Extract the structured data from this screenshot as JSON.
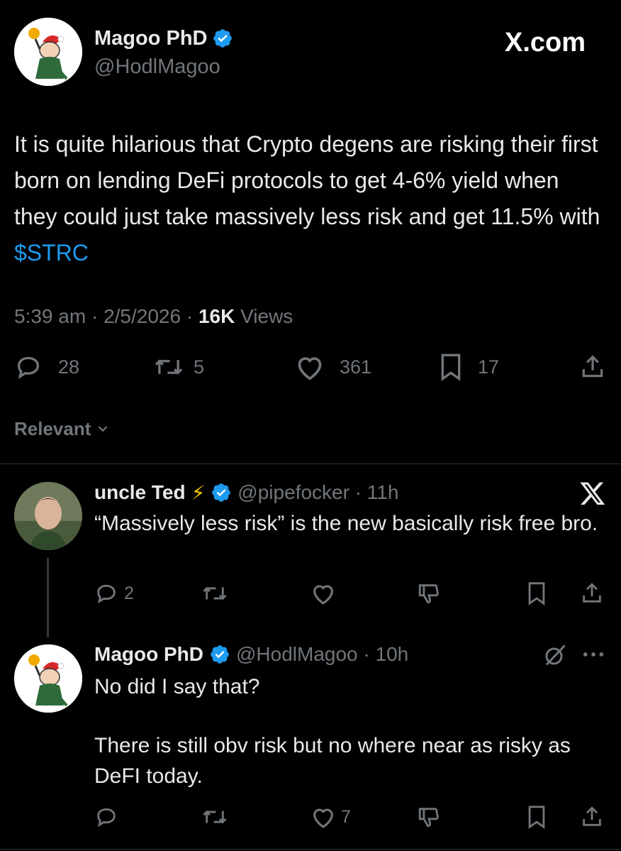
{
  "brand": {
    "site_logo_text": "X.com",
    "x_logo_text": "X"
  },
  "main_tweet": {
    "author_name": "Magoo PhD",
    "author_handle": "@HodlMagoo",
    "text_prefix": "It is quite hilarious that Crypto degens are risking their first born on lending DeFi protocols to get 4-6% yield when they could just take massively less risk and get 11.5% with ",
    "cashtag": "$STRC",
    "time": "5:39 am",
    "date": "2/5/2026",
    "views_count": "16K",
    "views_label": "Views",
    "replies": "28",
    "reposts": "5",
    "likes": "361",
    "bookmarks": "17"
  },
  "sort": {
    "label": "Relevant"
  },
  "reply1": {
    "author_name": "uncle Ted",
    "emoji": "⚡",
    "author_handle": "@pipefocker",
    "time": "11h",
    "text": "“Massively less risk” is the new basically risk free bro.",
    "replies": "2",
    "reposts": "",
    "likes": ""
  },
  "reply2": {
    "author_name": "Magoo PhD",
    "author_handle": "@HodlMagoo",
    "time": "10h",
    "text_line1": "No did I say that?",
    "text_line2": "There is still obv risk but no where near as risky as DeFI today.",
    "replies": "",
    "reposts": "",
    "likes": "7"
  },
  "colors": {
    "background": "#000000",
    "text": "#e7e9ea",
    "muted": "#71767b",
    "link": "#1d9bf0",
    "verified": "#1d9bf0",
    "divider": "#2f3336"
  },
  "icons": [
    "verified-badge-icon",
    "reply-icon",
    "repost-icon",
    "like-icon",
    "bookmark-icon",
    "share-icon",
    "dislike-icon",
    "grok-icon",
    "more-icon",
    "chevron-down-icon",
    "x-logo-icon"
  ]
}
